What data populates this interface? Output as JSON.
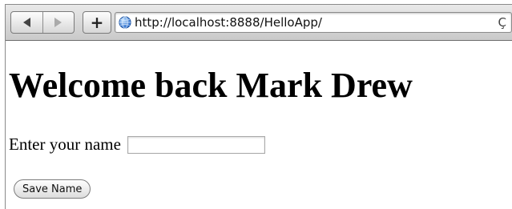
{
  "browser": {
    "url": "http://localhost:8888/HelloApp/",
    "add_label": "+",
    "reload_glyph": "Ç",
    "icons": {
      "back": "back-arrow-icon",
      "forward": "forward-arrow-icon",
      "site": "globe-icon",
      "reload": "reload-icon"
    }
  },
  "page": {
    "heading": "Welcome back Mark Drew",
    "form": {
      "name_label": "Enter your name",
      "name_value": "",
      "submit_label": "Save Name"
    }
  }
}
